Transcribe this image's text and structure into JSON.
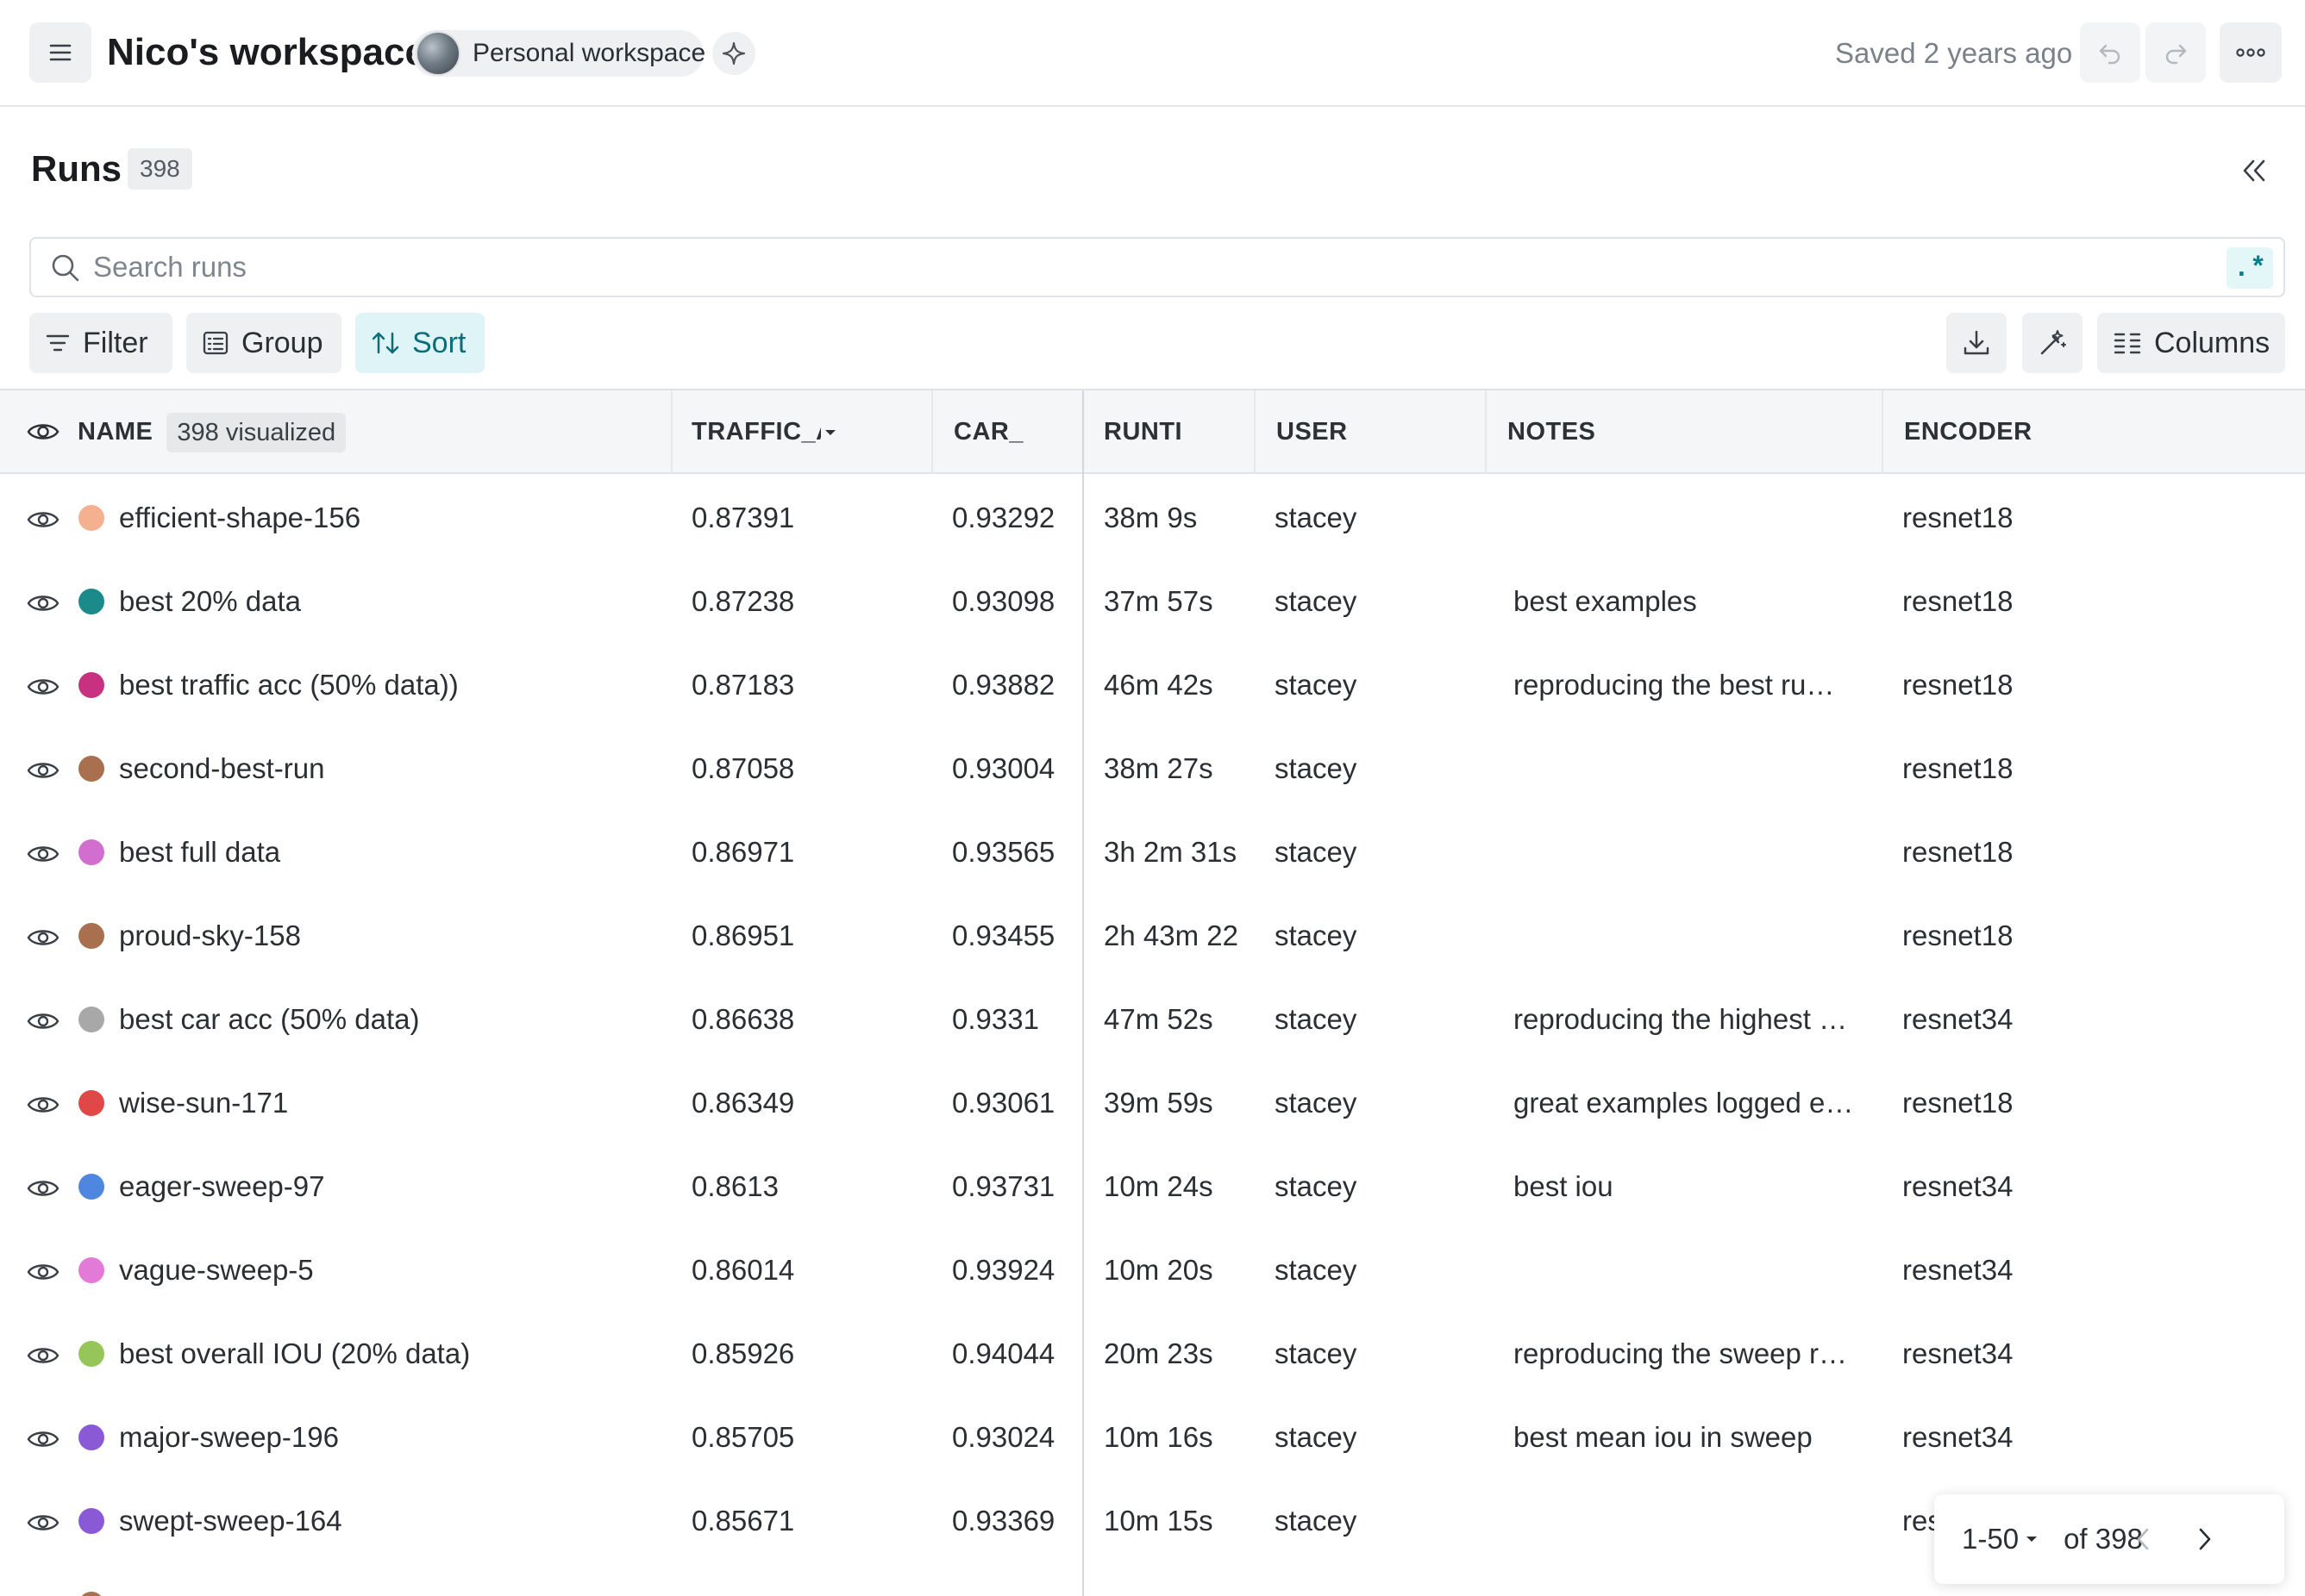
{
  "header": {
    "workspace_title": "Nico's workspace",
    "workspace_chip": "Personal workspace",
    "saved_status": "Saved 2 years ago"
  },
  "runs": {
    "title": "Runs",
    "count": "398"
  },
  "search": {
    "placeholder": "Search runs",
    "value": "",
    "regex_label": ".*"
  },
  "toolbar": {
    "filter_label": "Filter",
    "group_label": "Group",
    "sort_label": "Sort",
    "columns_label": "Columns"
  },
  "table": {
    "columns": {
      "name": "NAME",
      "visualized": "398 visualized",
      "traffic_acc": "TRAFFIC_AC",
      "car_acc": "CAR_",
      "runtime": "RUNTI",
      "user": "USER",
      "notes": "NOTES",
      "encoder": "ENCODER"
    },
    "rows": [
      {
        "name": "efficient-shape-156",
        "color": "#f5b08f",
        "traffic_acc": "0.87391",
        "car_acc": "0.93292",
        "runtime": "38m 9s",
        "user": "stacey",
        "notes": "",
        "encoder": "resnet18"
      },
      {
        "name": "best 20% data",
        "color": "#1a8a8a",
        "traffic_acc": "0.87238",
        "car_acc": "0.93098",
        "runtime": "37m 57s",
        "user": "stacey",
        "notes": "best examples",
        "encoder": "resnet18"
      },
      {
        "name": "best traffic acc (50% data))",
        "color": "#c8317f",
        "traffic_acc": "0.87183",
        "car_acc": "0.93882",
        "runtime": "46m 42s",
        "user": "stacey",
        "notes": "reproducing the best ru…",
        "encoder": "resnet18"
      },
      {
        "name": "second-best-run",
        "color": "#a9704f",
        "traffic_acc": "0.87058",
        "car_acc": "0.93004",
        "runtime": "38m 27s",
        "user": "stacey",
        "notes": "",
        "encoder": "resnet18"
      },
      {
        "name": "best full data",
        "color": "#d36ed1",
        "traffic_acc": "0.86971",
        "car_acc": "0.93565",
        "runtime": "3h 2m 31s",
        "user": "stacey",
        "notes": "",
        "encoder": "resnet18"
      },
      {
        "name": "proud-sky-158",
        "color": "#a9704f",
        "traffic_acc": "0.86951",
        "car_acc": "0.93455",
        "runtime": "2h 43m 22",
        "user": "stacey",
        "notes": "",
        "encoder": "resnet18"
      },
      {
        "name": "best car acc (50% data)",
        "color": "#a8a8a8",
        "traffic_acc": "0.86638",
        "car_acc": "0.9331",
        "runtime": "47m 52s",
        "user": "stacey",
        "notes": "reproducing the highest …",
        "encoder": "resnet34"
      },
      {
        "name": "wise-sun-171",
        "color": "#e04848",
        "traffic_acc": "0.86349",
        "car_acc": "0.93061",
        "runtime": "39m 59s",
        "user": "stacey",
        "notes": "great examples logged e…",
        "encoder": "resnet18"
      },
      {
        "name": "eager-sweep-97",
        "color": "#4e86e0",
        "traffic_acc": "0.8613",
        "car_acc": "0.93731",
        "runtime": "10m 24s",
        "user": "stacey",
        "notes": "best iou",
        "encoder": "resnet34"
      },
      {
        "name": "vague-sweep-5",
        "color": "#e27ad8",
        "traffic_acc": "0.86014",
        "car_acc": "0.93924",
        "runtime": "10m 20s",
        "user": "stacey",
        "notes": "",
        "encoder": "resnet34"
      },
      {
        "name": "best overall IOU (20% data)",
        "color": "#96c65a",
        "traffic_acc": "0.85926",
        "car_acc": "0.94044",
        "runtime": "20m 23s",
        "user": "stacey",
        "notes": "reproducing the sweep r…",
        "encoder": "resnet34"
      },
      {
        "name": "major-sweep-196",
        "color": "#8a5ad6",
        "traffic_acc": "0.85705",
        "car_acc": "0.93024",
        "runtime": "10m 16s",
        "user": "stacey",
        "notes": "best mean iou in sweep",
        "encoder": "resnet34"
      },
      {
        "name": "swept-sweep-164",
        "color": "#8a5ad6",
        "traffic_acc": "0.85671",
        "car_acc": "0.93369",
        "runtime": "10m 15s",
        "user": "stacey",
        "notes": "",
        "encoder": "res"
      },
      {
        "name": "",
        "color": "#a9704f",
        "traffic_acc": "",
        "car_acc": "",
        "runtime": "",
        "user": "",
        "notes": "",
        "encoder": ""
      }
    ]
  },
  "pagination": {
    "range": "1-50",
    "total": "of 398"
  },
  "colors": {
    "accent": "#0b6d79",
    "accent_bg": "#dff4f6"
  }
}
